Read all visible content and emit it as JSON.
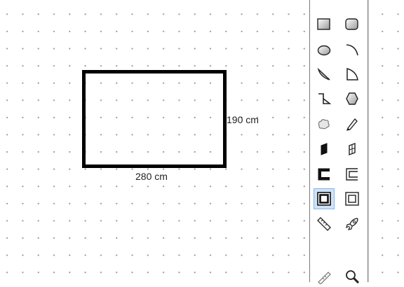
{
  "canvas": {
    "room": {
      "width_label": "280 cm",
      "height_label": "190 cm"
    }
  },
  "toolbar": {
    "selected_tool": "double-wall-rect",
    "tools": [
      [
        "rectangle",
        "rounded-rectangle"
      ],
      [
        "ellipse",
        "arc"
      ],
      [
        "chord",
        "pie-segment"
      ],
      [
        "polyline-corner",
        "hexagon"
      ],
      [
        "freeform-shape",
        "pencil"
      ],
      [
        "door",
        "window"
      ],
      [
        "open-wall-bracket",
        "open-wall-double-bracket"
      ],
      [
        "double-wall-rect",
        "wall-rect"
      ],
      [
        "ruler",
        "rocket"
      ],
      [
        "measure-tape",
        "zoom"
      ]
    ]
  }
}
